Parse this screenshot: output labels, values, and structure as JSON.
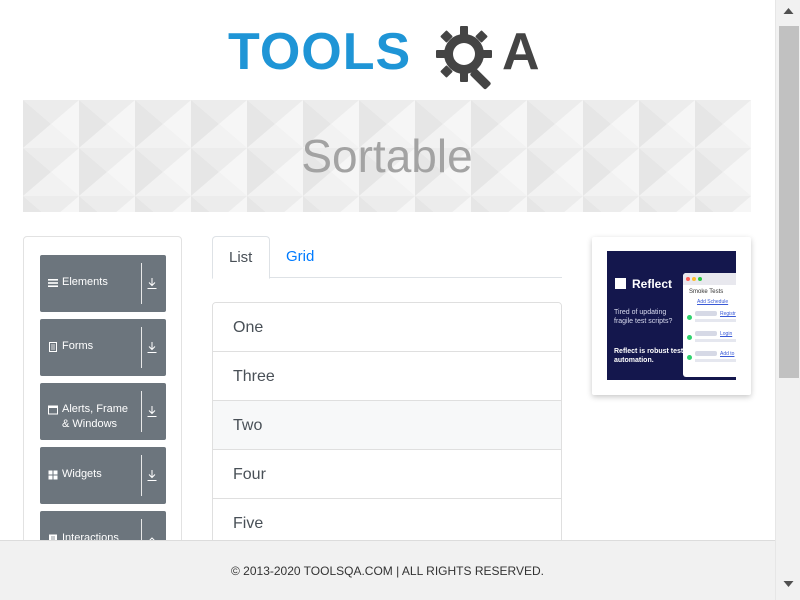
{
  "logo": {
    "text_left": "TOOLS",
    "text_right": "A",
    "gear_icon": "gear-magnifier-icon",
    "color_primary": "#1f95d6",
    "color_dark": "#444444"
  },
  "banner": {
    "title": "Sortable"
  },
  "sidebar": {
    "groups": [
      {
        "label": "Elements",
        "icon": "hamburger-icon"
      },
      {
        "label": "Forms",
        "icon": "document-icon"
      },
      {
        "label": "Alerts, Frame & Windows",
        "icon": "window-icon"
      },
      {
        "label": "Widgets",
        "icon": "grid-icon"
      },
      {
        "label": "Interactions",
        "icon": "book-icon"
      }
    ],
    "group_color": "#6c757d"
  },
  "tabs": [
    {
      "label": "List",
      "active": true
    },
    {
      "label": "Grid",
      "active": false
    }
  ],
  "list": {
    "items": [
      "One",
      "Three",
      "Two",
      "Four",
      "Five"
    ]
  },
  "ad": {
    "brand": "Reflect",
    "tagline": "Tired of updating fragile test scripts?",
    "tagline_strong": "Reflect is robust test automation.",
    "screenshot_title": "Smoke Tests",
    "screenshot_link": "Add Schedule",
    "rows": [
      "Registr",
      "Login",
      "Add to"
    ],
    "bg_color": "#14174d"
  },
  "footer": {
    "text": "© 2013-2020 TOOLSQA.COM | ALL RIGHTS RESERVED."
  }
}
